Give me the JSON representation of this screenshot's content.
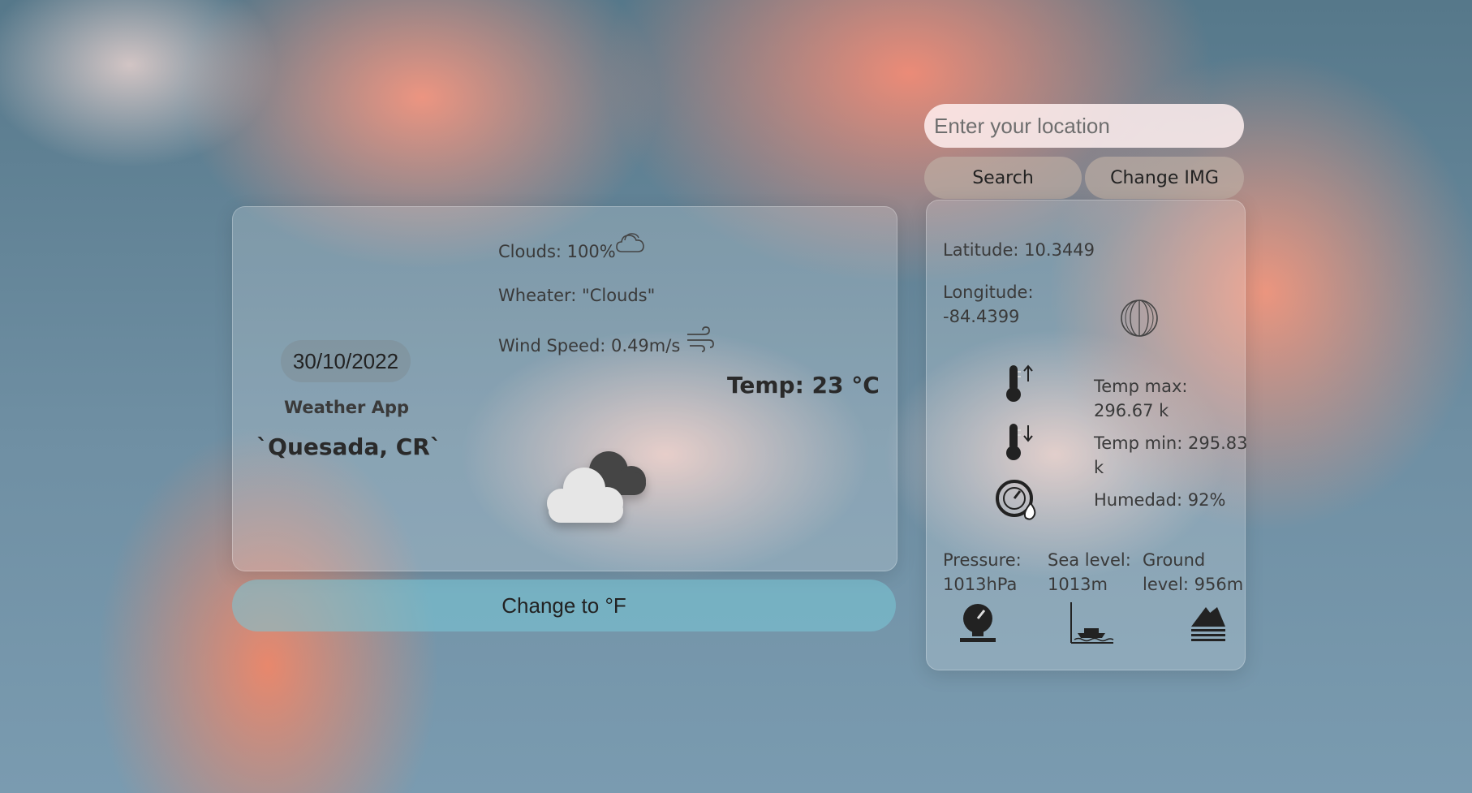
{
  "main_card": {
    "date": "30/10/2022",
    "app_title": "Weather App",
    "city": "`Quesada, CR`",
    "clouds": "Clouds: 100%",
    "weather": "Wheater: \"Clouds\"",
    "wind": "Wind Speed: 0.49m/s",
    "temp": "Temp: 23 °C"
  },
  "unit_button": "Change to °F",
  "search": {
    "placeholder": "Enter your location"
  },
  "buttons": {
    "search": "Search",
    "change_img": "Change IMG"
  },
  "details": {
    "latitude": "Latitude: 10.3449",
    "longitude_label": "Longitude:",
    "longitude_value": "-84.4399",
    "temp_max_label": "Temp max:",
    "temp_max_value": "296.67 k",
    "temp_min_label": "Temp min: 295.83",
    "temp_min_value": "k",
    "humidity": "Humedad: 92%",
    "pressure_label": "Pressure:",
    "pressure_value": "1013hPa",
    "sea_label": "Sea level:",
    "sea_value": "1013m",
    "ground_label": "Ground",
    "ground_value": "level: 956m"
  },
  "icons": [
    "cloud-outline-icon",
    "wind-icon",
    "weather-clouds-icon",
    "globe-icon",
    "thermometer-up-icon",
    "thermometer-down-icon",
    "humidity-gauge-icon",
    "pressure-gauge-icon",
    "sea-level-icon",
    "ground-level-icon"
  ]
}
